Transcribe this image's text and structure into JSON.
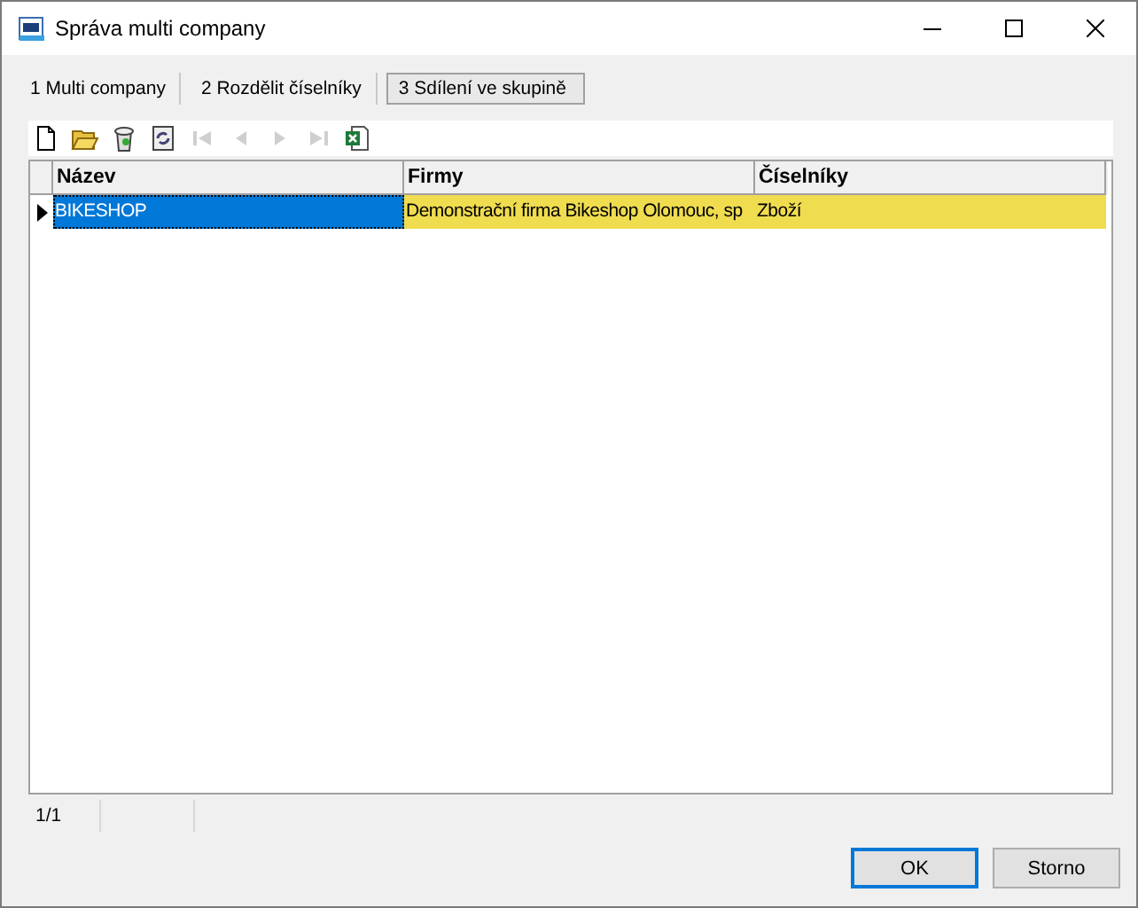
{
  "window": {
    "title": "Správa multi company"
  },
  "tabs": [
    {
      "label": "1 Multi company",
      "selected": false
    },
    {
      "label": "2 Rozdělit číselníky",
      "selected": false
    },
    {
      "label": "3 Sdílení ve skupině",
      "selected": true
    }
  ],
  "toolbar": [
    {
      "kind": "new",
      "disabled": false
    },
    {
      "kind": "open",
      "disabled": false
    },
    {
      "kind": "delete",
      "disabled": false
    },
    {
      "kind": "refresh",
      "disabled": false
    },
    {
      "kind": "first",
      "disabled": true
    },
    {
      "kind": "prev",
      "disabled": true
    },
    {
      "kind": "next",
      "disabled": true
    },
    {
      "kind": "last",
      "disabled": true
    },
    {
      "kind": "excel",
      "disabled": false
    }
  ],
  "table": {
    "columns": [
      "Název",
      "Firmy",
      "Číselníky"
    ],
    "rows": [
      {
        "selected": true,
        "cells": [
          "BIKESHOP",
          "Demonstrační firma Bikeshop Olomouc, sp",
          "Zboží"
        ]
      }
    ]
  },
  "status_bar": [
    "1/1"
  ],
  "buttons": [
    {
      "label": "OK",
      "default": true
    },
    {
      "label": "Storno",
      "default": false
    }
  ]
}
